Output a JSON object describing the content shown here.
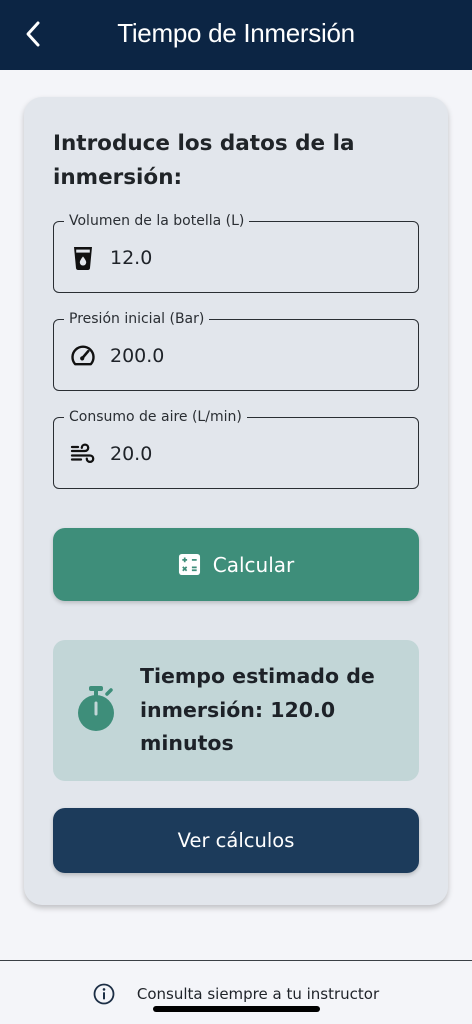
{
  "appbar": {
    "title": "Tiempo de Inmersión",
    "back_icon": "chevron-left-icon"
  },
  "card": {
    "heading": "Introduce los datos de la inmersión:",
    "fields": [
      {
        "label": "Volumen de la botella (L)",
        "value": "12.0",
        "icon": "bottle-icon"
      },
      {
        "label": "Presión inicial (Bar)",
        "value": "200.0",
        "icon": "gauge-icon"
      },
      {
        "label": "Consumo de aire (L/min)",
        "value": "20.0",
        "icon": "air-icon"
      }
    ],
    "calculate_label": "Calcular",
    "calculate_icon": "calculator-icon",
    "result_text": "Tiempo estimado de inmersión: 120.0 minutos",
    "result_icon": "stopwatch-icon",
    "view_calculations_label": "Ver cálculos"
  },
  "footer": {
    "text": "Consulta siempre a tu instructor",
    "icon": "info-icon"
  },
  "colors": {
    "appbar": "#0c2544",
    "card": "#e2e6ec",
    "primary_green": "#3e8e7a",
    "result_bg": "#c2d6d7",
    "navy_button": "#1c3b5b"
  }
}
